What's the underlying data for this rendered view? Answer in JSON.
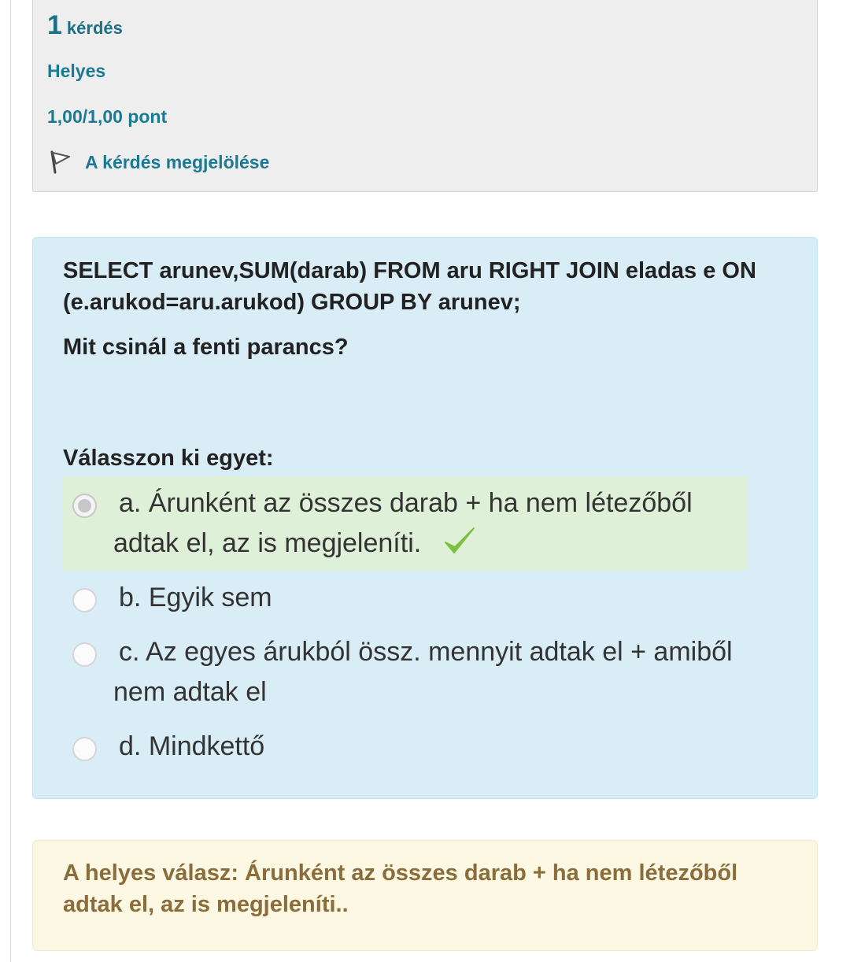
{
  "info": {
    "question_number": "1",
    "question_word": "kérdés",
    "state": "Helyes",
    "grade": "1,00/1,00 pont",
    "flag_label": "A kérdés megjelölése"
  },
  "question": {
    "sql": "SELECT arunev,SUM(darab) FROM aru RIGHT JOIN eladas e ON (e.arukod=aru.arukod) GROUP BY arunev;",
    "text": "Mit csinál a fenti parancs?",
    "prompt": "Válasszon ki egyet:"
  },
  "answers": [
    {
      "letter": "a.",
      "text": "Árunként az összes darab + ha nem létezőből adtak el, az is megjeleníti.",
      "selected": true,
      "correct": true
    },
    {
      "letter": "b.",
      "text": "Egyik sem",
      "selected": false
    },
    {
      "letter": "c.",
      "text": "Az egyes árukból össz. mennyit adtak el + amiből nem adtak el",
      "selected": false
    },
    {
      "letter": "d.",
      "text": "Mindkettő",
      "selected": false
    }
  ],
  "feedback": {
    "right_answer": "A helyes válasz: Árunként az összes darab + ha nem létezőből adtak el, az is megjeleníti.."
  },
  "colors": {
    "link": "#1b7a93",
    "question_bg": "#d9edf7",
    "correct_bg": "#dff0d8",
    "feedback_bg": "#fcf8e3",
    "feedback_text": "#8a6d3b",
    "check": "#7bc13c"
  },
  "icons": {
    "flag": "flag-icon",
    "correct": "check-icon"
  }
}
